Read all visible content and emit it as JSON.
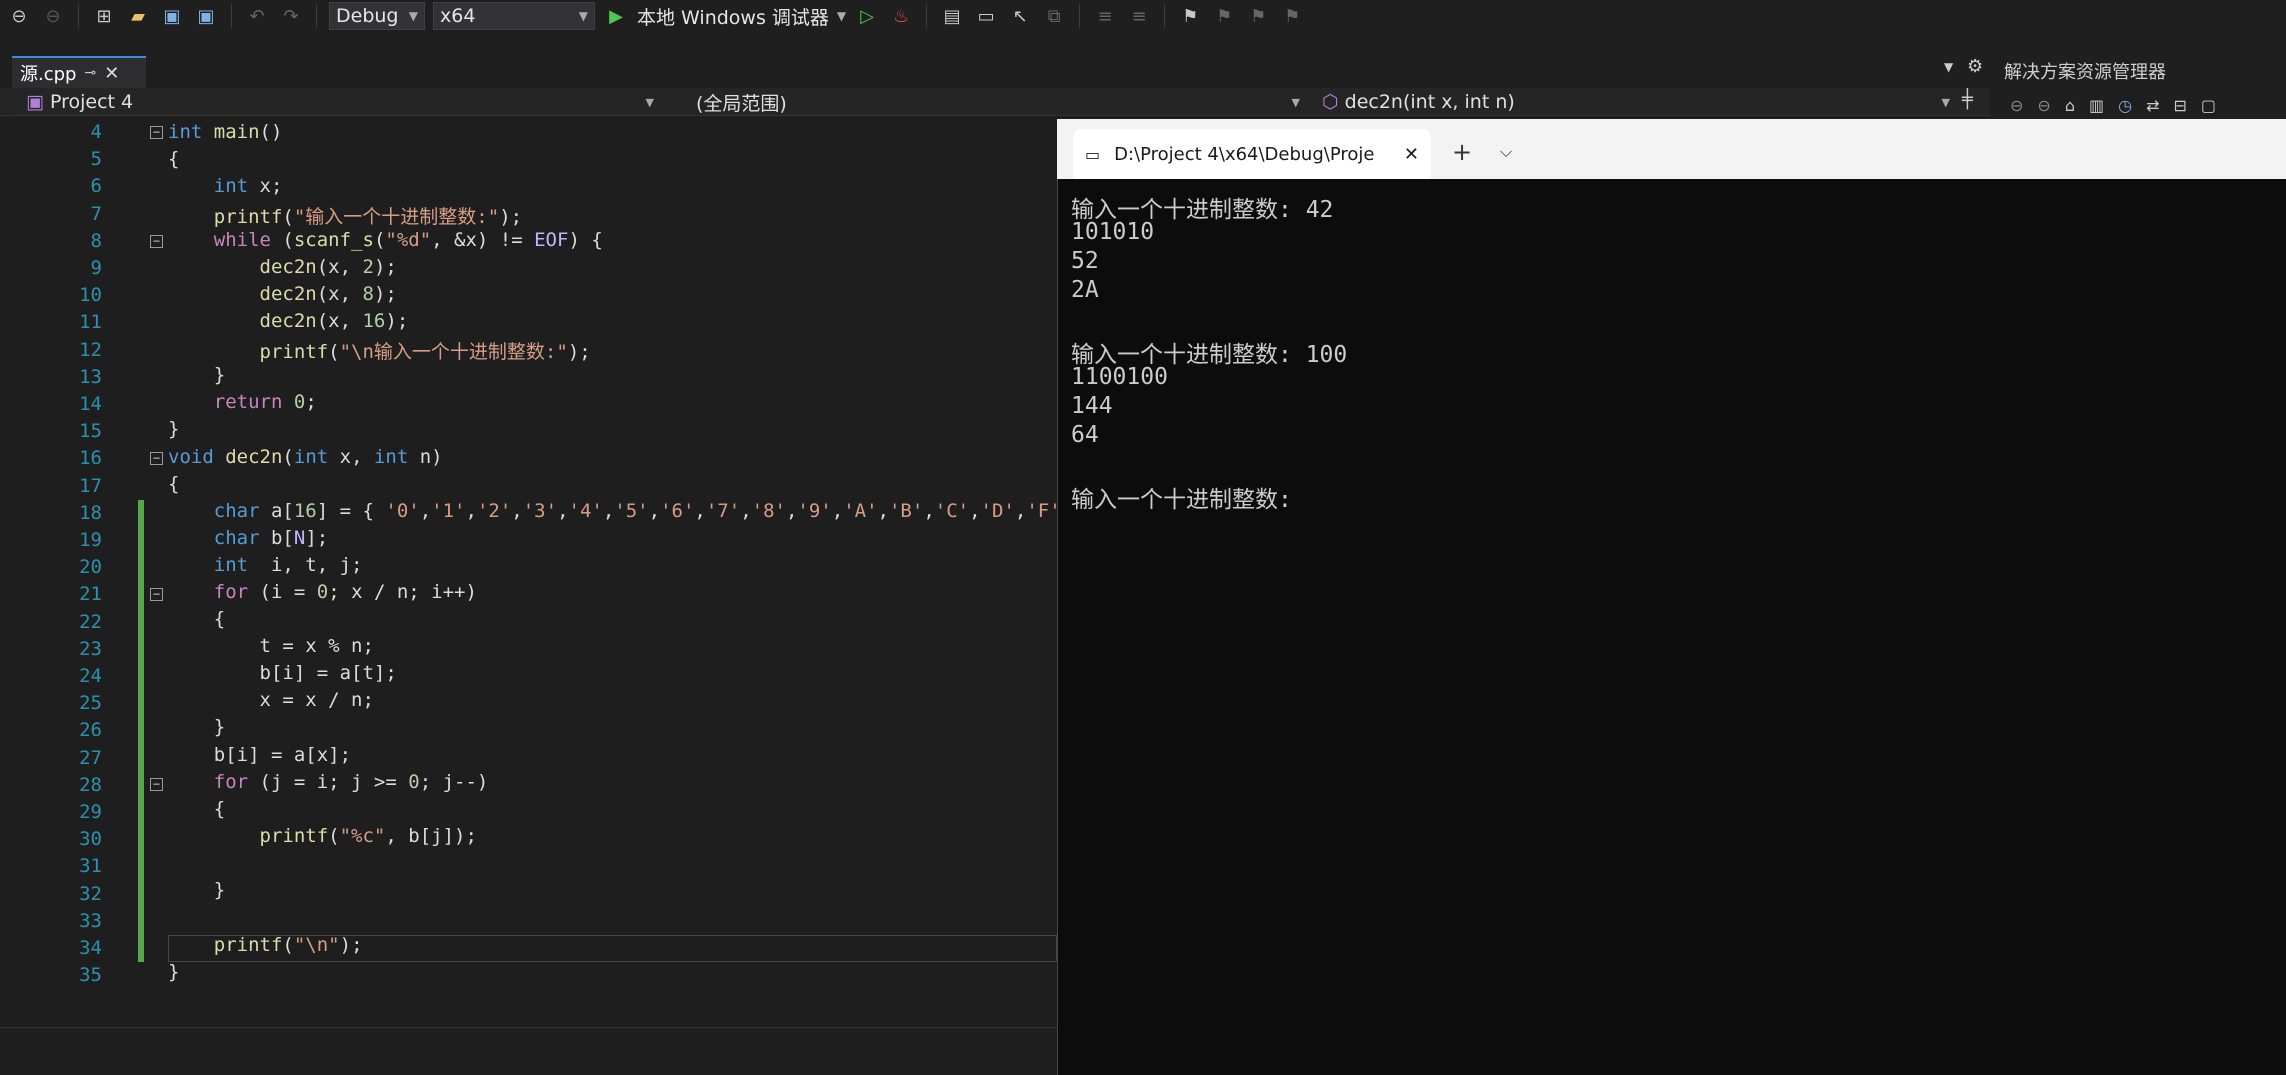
{
  "toolbar": {
    "config": "Debug",
    "platform": "x64",
    "run_label": "本地 Windows 调试器"
  },
  "tab": {
    "filename": "源.cpp"
  },
  "nav": {
    "project": "Project 4",
    "scope": "(全局范围)",
    "member": "dec2n(int x, int n)"
  },
  "solution_explorer": {
    "title": "解决方案资源管理器"
  },
  "terminal": {
    "tab_title": "D:\\Project 4\\x64\\Debug\\Proje",
    "lines": [
      "输入一个十进制整数: 42",
      "101010",
      "52",
      "2A",
      "",
      "输入一个十进制整数: 100",
      "1100100",
      "144",
      "64",
      "",
      "输入一个十进制整数:"
    ]
  },
  "editor": {
    "line_numbers": [
      "4",
      "5",
      "6",
      "7",
      "8",
      "9",
      "10",
      "11",
      "12",
      "13",
      "14",
      "15",
      "16",
      "17",
      "18",
      "19",
      "20",
      "21",
      "22",
      "23",
      "24",
      "25",
      "26",
      "27",
      "28",
      "29",
      "30",
      "31",
      "32",
      "33",
      "34",
      "35"
    ]
  },
  "colors": {
    "accent": "#3b8ede",
    "keyword": "#569cd6",
    "string": "#d69d85",
    "number": "#b5cea8",
    "linenum": "#2b91af",
    "change_bar": "#57a64a"
  }
}
